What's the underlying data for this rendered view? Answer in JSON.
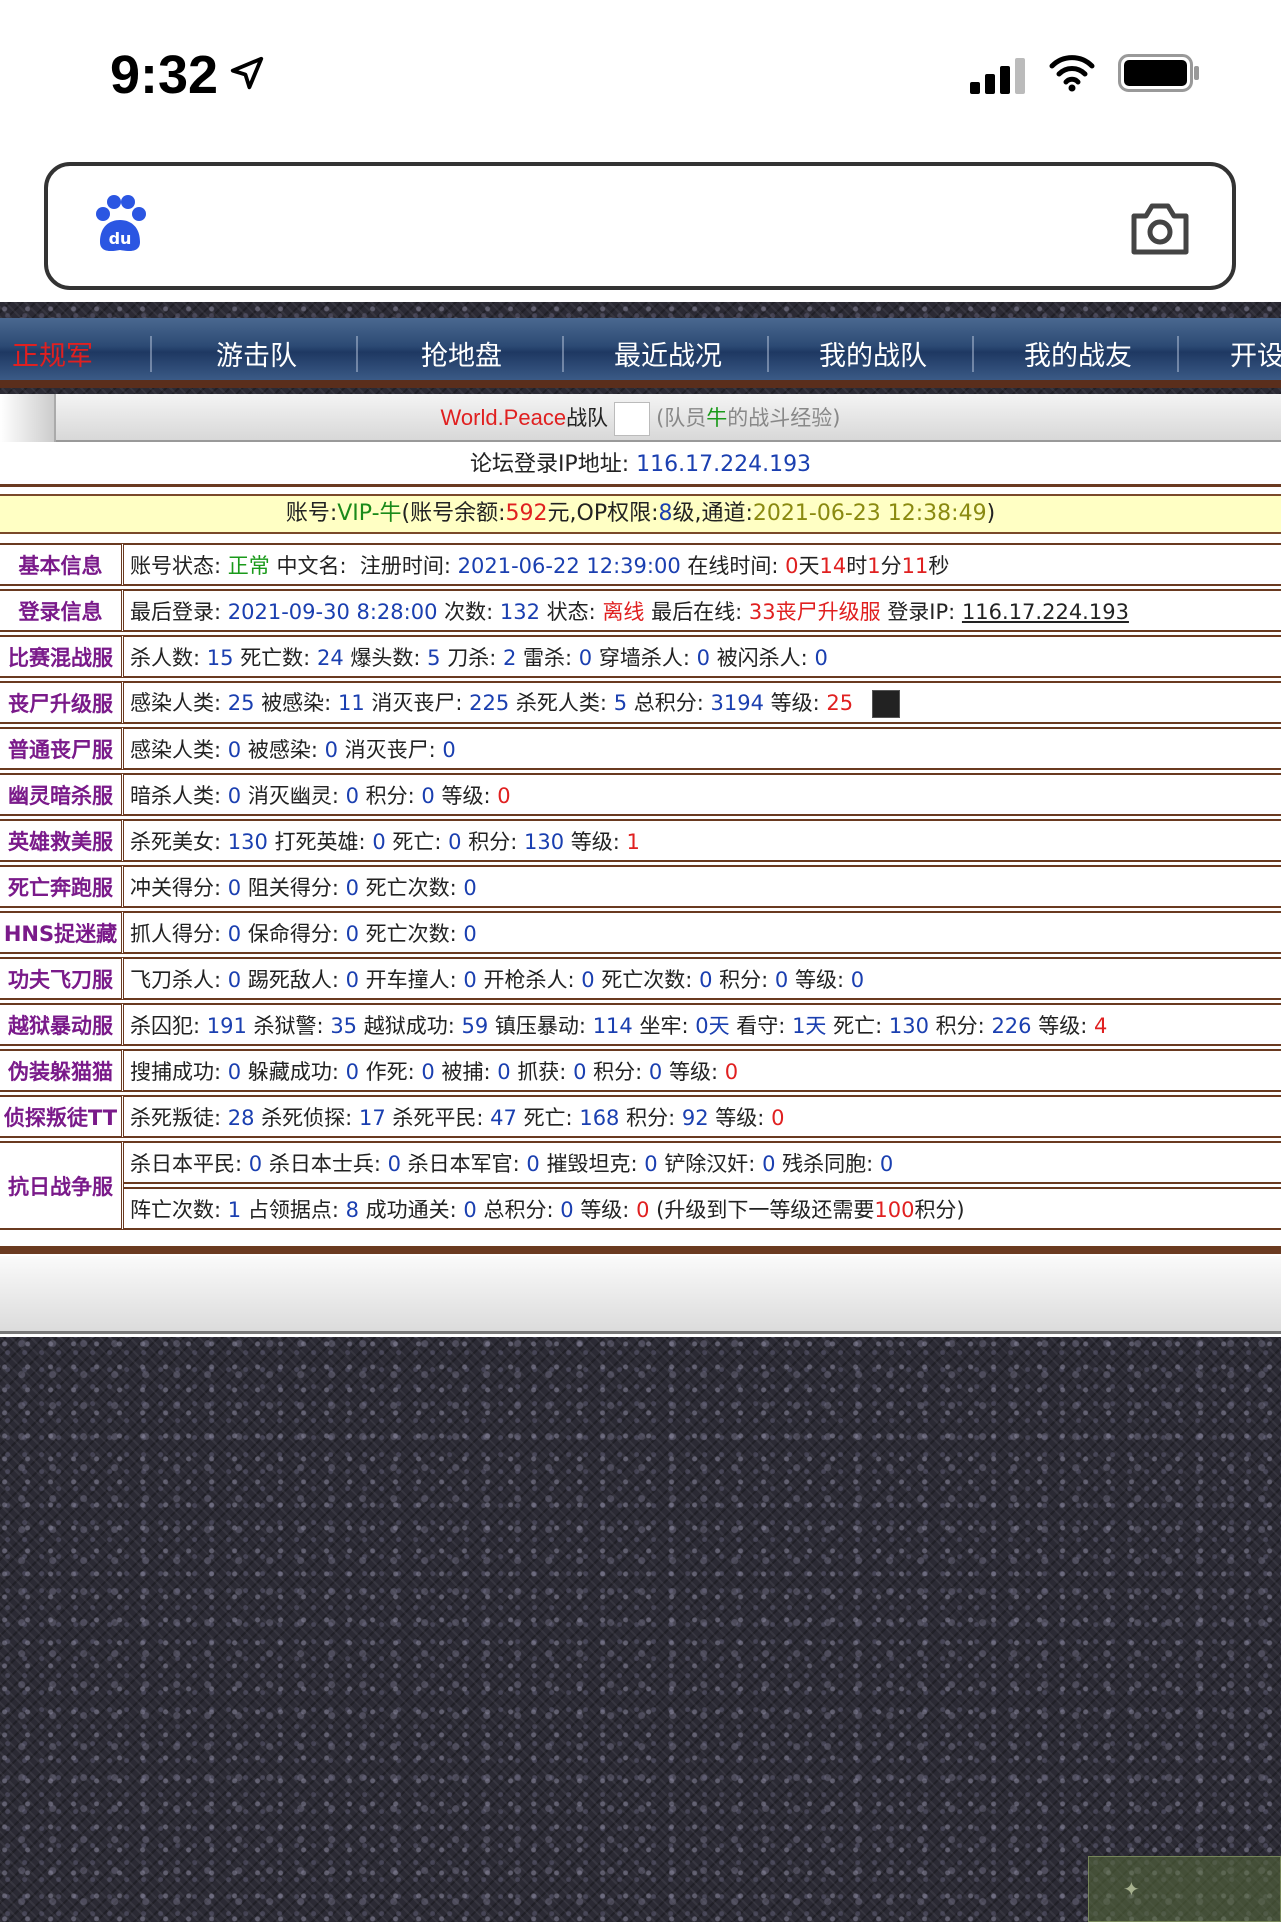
{
  "status_bar": {
    "time": "9:32"
  },
  "nav": {
    "items": [
      {
        "label": "正规军"
      },
      {
        "label": "游击队"
      },
      {
        "label": "抢地盘"
      },
      {
        "label": "最近战况"
      },
      {
        "label": "我的战队"
      },
      {
        "label": "我的战友"
      },
      {
        "label": "开设"
      }
    ],
    "active_color": "#e02020"
  },
  "team": {
    "name": "World.Peace",
    "suffix": "战队",
    "note_prefix": "(队员",
    "member": "牛",
    "note_suffix": "的战斗经验)"
  },
  "ip": {
    "label": "论坛登录IP地址:",
    "value": "116.17.224.193"
  },
  "account": {
    "p1": "账号:",
    "name": "VIP-牛",
    "p2": "(账号余额:",
    "balance": "592",
    "p3": "元,OP权限:",
    "op_level": "8",
    "p4": "级,通道:",
    "channel_time": "2021-06-23 12:38:49",
    "p5": ")"
  },
  "rows": {
    "basic": {
      "label": "基本信息",
      "status_label": "账号状态:",
      "status": "正常",
      "cn_label": "中文名:",
      "reg_label": "注册时间:",
      "reg_time": "2021-06-22 12:39:00",
      "online_label": "在线时间:",
      "days": "0",
      "days_unit": "天",
      "hours": "14",
      "hours_unit": "时",
      "minutes": "1",
      "minutes_unit": "分",
      "seconds": "11",
      "seconds_unit": "秒"
    },
    "login": {
      "label": "登录信息",
      "last_label": "最后登录:",
      "last": "2021-09-30 8:28:00",
      "count_label": "次数:",
      "count": "132",
      "state_label": "状态:",
      "state": "离线",
      "last_online_label": "最后在线:",
      "last_online": "33丧尸升级服",
      "ip_label": "登录IP:",
      "ip": "116.17.224.193"
    },
    "mixed": {
      "label": "比赛混战服",
      "k1": "杀人数:",
      "v1": "15",
      "k2": "死亡数:",
      "v2": "24",
      "k3": "爆头数:",
      "v3": "5",
      "k4": "刀杀:",
      "v4": "2",
      "k5": "雷杀:",
      "v5": "0",
      "k6": "穿墙杀人:",
      "v6": "0",
      "k7": "被闪杀人:",
      "v7": "0"
    },
    "zombie_up": {
      "label": "丧尸升级服",
      "k1": "感染人类:",
      "v1": "25",
      "k2": "被感染:",
      "v2": "11",
      "k3": "消灭丧尸:",
      "v3": "225",
      "k4": "杀死人类:",
      "v4": "5",
      "k5": "总积分:",
      "v5": "3194",
      "k6": "等级:",
      "v6": "25"
    },
    "zombie": {
      "label": "普通丧尸服",
      "k1": "感染人类:",
      "v1": "0",
      "k2": "被感染:",
      "v2": "0",
      "k3": "消灭丧尸:",
      "v3": "0"
    },
    "ghost": {
      "label": "幽灵暗杀服",
      "k1": "暗杀人类:",
      "v1": "0",
      "k2": "消灭幽灵:",
      "v2": "0",
      "k3": "积分:",
      "v3": "0",
      "k4": "等级:",
      "v4": "0"
    },
    "hero": {
      "label": "英雄救美服",
      "k1": "杀死美女:",
      "v1": "130",
      "k2": "打死英雄:",
      "v2": "0",
      "k3": "死亡:",
      "v3": "0",
      "k4": "积分:",
      "v4": "130",
      "k5": "等级:",
      "v5": "1"
    },
    "deathrun": {
      "label": "死亡奔跑服",
      "k1": "冲关得分:",
      "v1": "0",
      "k2": "阻关得分:",
      "v2": "0",
      "k3": "死亡次数:",
      "v3": "0"
    },
    "hns": {
      "label": "HNS捉迷藏",
      "k1": "抓人得分:",
      "v1": "0",
      "k2": "保命得分:",
      "v2": "0",
      "k3": "死亡次数:",
      "v3": "0"
    },
    "knife": {
      "label": "功夫飞刀服",
      "k1": "飞刀杀人:",
      "v1": "0",
      "k2": "踢死敌人:",
      "v2": "0",
      "k3": "开车撞人:",
      "v3": "0",
      "k4": "开枪杀人:",
      "v4": "0",
      "k5": "死亡次数:",
      "v5": "0",
      "k6": "积分:",
      "v6": "0",
      "k7": "等级:",
      "v7": "0"
    },
    "jail": {
      "label": "越狱暴动服",
      "k1": "杀囚犯:",
      "v1": "191",
      "k2": "杀狱警:",
      "v2": "35",
      "k3": "越狱成功:",
      "v3": "59",
      "k4": "镇压暴动:",
      "v4": "114",
      "k5": "坐牢:",
      "v5": "0天",
      "k6": "看守:",
      "v6": "1天",
      "k7": "死亡:",
      "v7": "130",
      "k8": "积分:",
      "v8": "226",
      "k9": "等级:",
      "v9": "4"
    },
    "prop": {
      "label": "伪装躲猫猫",
      "k1": "搜捕成功:",
      "v1": "0",
      "k2": "躲藏成功:",
      "v2": "0",
      "k3": "作死:",
      "v3": "0",
      "k4": "被捕:",
      "v4": "0",
      "k5": "抓获:",
      "v5": "0",
      "k6": "积分:",
      "v6": "0",
      "k7": "等级:",
      "v7": "0"
    },
    "traitor": {
      "label": "侦探叛徒TT",
      "k1": "杀死叛徒:",
      "v1": "28",
      "k2": "杀死侦探:",
      "v2": "17",
      "k3": "杀死平民:",
      "v3": "47",
      "k4": "死亡:",
      "v4": "168",
      "k5": "积分:",
      "v5": "92",
      "k6": "等级:",
      "v6": "0"
    },
    "war": {
      "label": "抗日战争服",
      "a1": "杀日本平民:",
      "b1": "0",
      "a2": "杀日本士兵:",
      "b2": "0",
      "a3": "杀日本军官:",
      "b3": "0",
      "a4": "摧毁坦克:",
      "b4": "0",
      "a5": "铲除汉奸:",
      "b5": "0",
      "a6": "残杀同胞:",
      "b6": "0",
      "c1": "阵亡次数:",
      "d1": "1",
      "c2": "占领据点:",
      "d2": "8",
      "c3": "成功通关:",
      "d3": "0",
      "c4": "总积分:",
      "d4": "0",
      "c5": "等级:",
      "d5": "0",
      "next_prefix": "(升级到下一等级还需要",
      "next_points": "100",
      "next_suffix": "积分)"
    }
  }
}
